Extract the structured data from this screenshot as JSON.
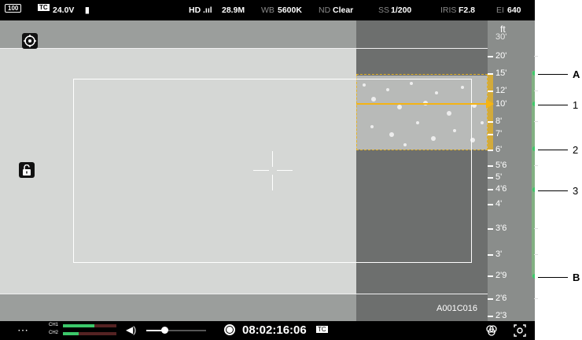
{
  "top_status": {
    "battery_percent": "100",
    "timecode_badge": "TC",
    "voltage": "24.0V",
    "resolution": "HD",
    "signal": "28.9M",
    "wb_label": "WB",
    "wb_value": "5600K",
    "nd_label": "ND",
    "nd_value": "Clear",
    "ss_label": "SS",
    "ss_value": "1/200",
    "iris_label": "IRIS",
    "iris_value": "F2.8",
    "ei_label": "EI",
    "ei_value": "640"
  },
  "focus_scale": {
    "unit": "ft",
    "labels": [
      "30'",
      "20'",
      "15'",
      "12'",
      "10'",
      "8'",
      "7'",
      "6'",
      "5'6",
      "5'",
      "4'6",
      "4'",
      "3'6",
      "3'",
      "2'9",
      "2'6",
      "2'3"
    ],
    "current": "10'"
  },
  "callouts": [
    "A",
    "1",
    "2",
    "3",
    "B"
  ],
  "clip_name": "A001C016",
  "bottom_bar": {
    "menu": "⋯",
    "ch1": "CH1",
    "ch2": "CH2",
    "volume_level": 0.3,
    "timecode": "08:02:16:06",
    "tc_badge": "TC"
  },
  "colors": {
    "focus_accent": "#f5b414",
    "peak_green": "#3cc86a"
  }
}
